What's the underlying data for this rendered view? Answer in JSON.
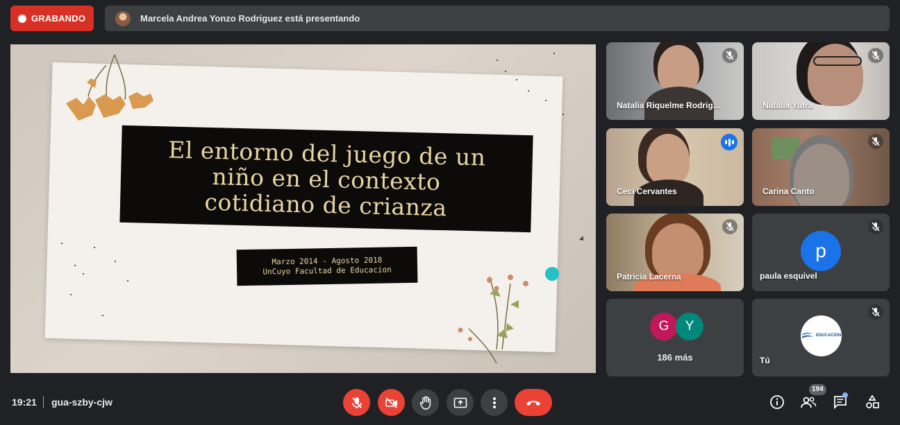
{
  "recording": {
    "label": "GRABANDO"
  },
  "presenter_banner": {
    "text": "Marcela Andrea Yonzo Rodriguez está presentando"
  },
  "slide": {
    "title_lines": [
      "El entorno del juego de un",
      "niño en el contexto",
      "cotidiano de crianza"
    ],
    "subtitle_lines": [
      "Marzo 2014 - Agosto 2018",
      "UnCuyo Facultad de Educacion"
    ]
  },
  "participants": [
    {
      "name": "Natalia Riquelme Rodrig...",
      "muted": true
    },
    {
      "name": "Natalia Yufra",
      "muted": true
    },
    {
      "name": "Ceci Cervantes",
      "muted": false,
      "speaking": true
    },
    {
      "name": "Carina Canto",
      "muted": true
    },
    {
      "name": "Patricia Lacerna",
      "muted": true
    },
    {
      "name": "paula esquivel",
      "muted": true,
      "avatar_letter": "p"
    }
  ],
  "more_tile": {
    "avatars": [
      {
        "letter": "G",
        "color": "#c2185b"
      },
      {
        "letter": "Y",
        "color": "#00897b"
      }
    ],
    "label": "186 más"
  },
  "self_tile": {
    "name": "Tú",
    "muted": true,
    "logo_text": "EDUCACIÓN"
  },
  "footer": {
    "time": "19:21",
    "meeting_code": "gua-szby-cjw",
    "participant_count": "194"
  },
  "controls": [
    "mic-off-icon",
    "camera-off-icon",
    "raise-hand-icon",
    "present-icon",
    "more-options-icon",
    "end-call-icon"
  ],
  "colors": {
    "recording": "#d93025",
    "danger": "#ea4335",
    "accent": "#1a73e8",
    "background": "#202124",
    "surface": "#3c4043"
  }
}
